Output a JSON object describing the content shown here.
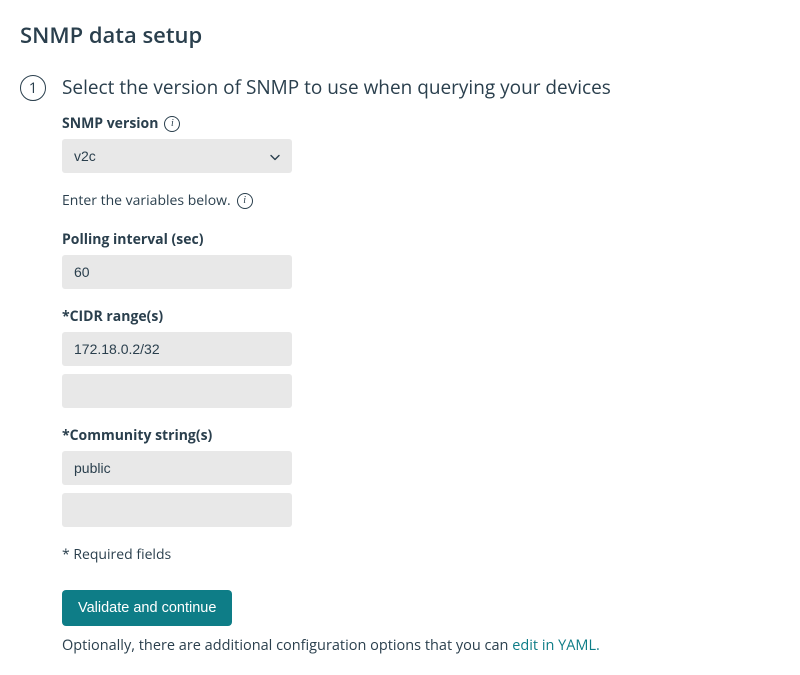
{
  "page": {
    "title": "SNMP data setup"
  },
  "step": {
    "number": "1",
    "heading": "Select the version of SNMP to use when querying your devices"
  },
  "form": {
    "snmp_version": {
      "label": "SNMP version",
      "value": "v2c"
    },
    "helper": "Enter the variables below.",
    "polling_interval": {
      "label": "Polling interval (sec)",
      "value": "60"
    },
    "cidr": {
      "label": "*CIDR range(s)",
      "values": [
        "172.18.0.2/32",
        ""
      ]
    },
    "community": {
      "label": "*Community string(s)",
      "values": [
        "public",
        ""
      ]
    },
    "required_note": "* Required fields",
    "button": "Validate and continue",
    "footer_prefix": "Optionally, there are additional configuration options that you can ",
    "footer_link": "edit in YAML."
  }
}
